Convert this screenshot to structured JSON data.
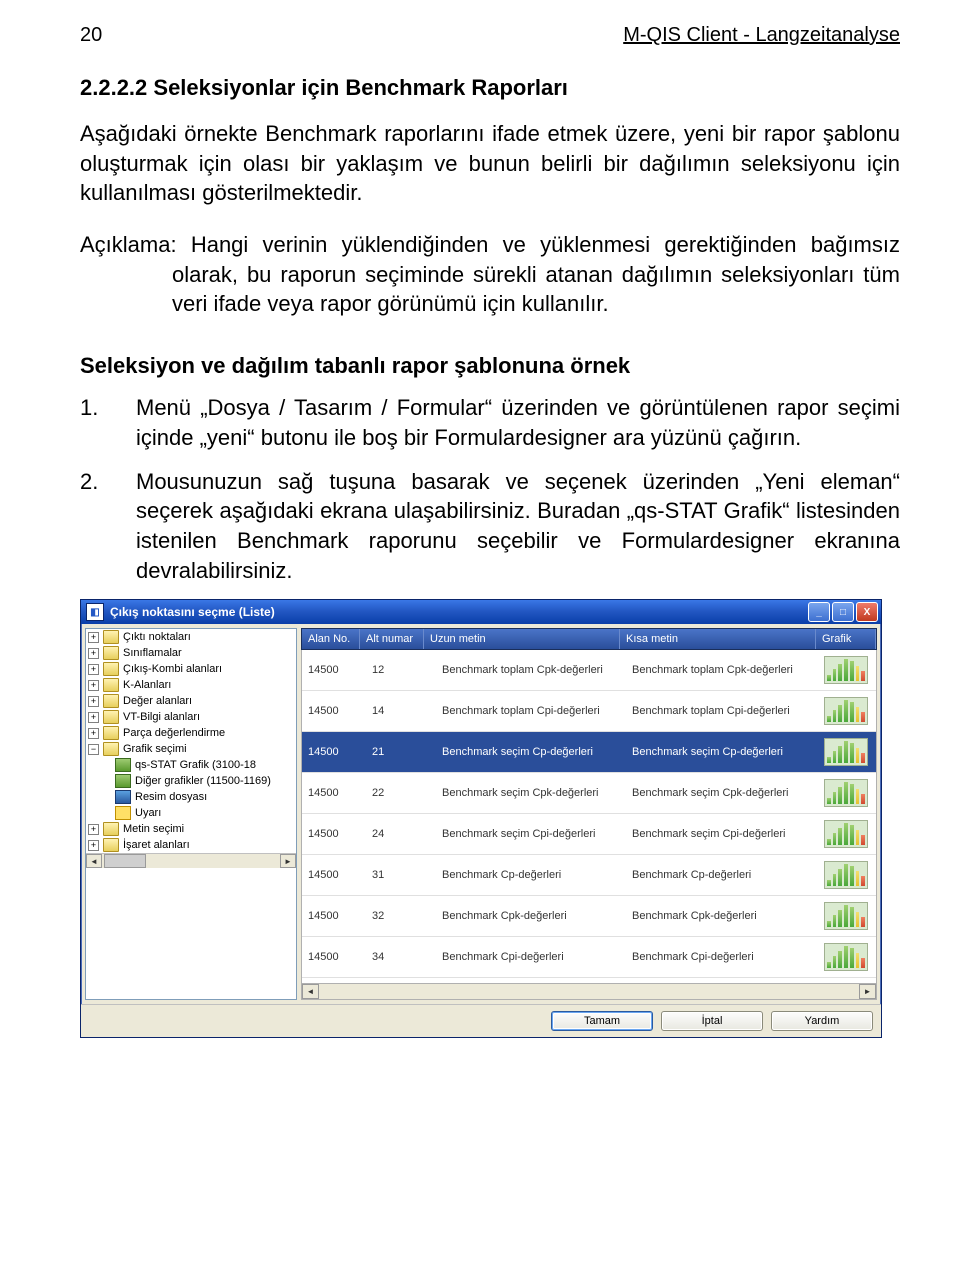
{
  "header": {
    "page_no": "20",
    "doc_title": "M-QIS Client - Langzeitanalyse"
  },
  "section": {
    "num_title": "2.2.2.2  Seleksiyonlar için Benchmark Raporları"
  },
  "para1": "Aşağıdaki örnekte Benchmark raporlarını ifade etmek üzere, yeni bir rapor şablonu oluşturmak için olası bir yaklaşım ve bunun belirli bir dağılımın seleksiyonu için kullanılması gösterilmektedir.",
  "para2": "Açıklama: Hangi verinin yüklendiğinden ve yüklenmesi gerektiğinden bağımsız olarak, bu raporun seçiminde sürekli atanan dağılımın seleksiyonları tüm veri ifade veya rapor görünümü için kullanılır.",
  "subheading": "Seleksiyon ve dağılım tabanlı rapor şablonuna örnek",
  "list": {
    "item1_num": "1.",
    "item1_txt": "Menü „Dosya / Tasarım / Formular“ üzerinden ve görüntülenen rapor seçimi içinde „yeni“ butonu ile boş bir Formulardesigner ara yüzünü çağırın.",
    "item2_num": "2.",
    "item2_txt": "Mousunuzun sağ tuşuna basarak ve seçenek üzerinden „Yeni eleman“ seçerek aşağıdaki ekrana ulaşabilirsiniz. Buradan „qs-STAT Grafik“ listesinden istenilen Benchmark raporunu seçebilir ve Formulardesigner ekranına devralabilirsiniz."
  },
  "window": {
    "title": "Çıkış noktasını seçme (Liste)",
    "tree": [
      {
        "indent": 0,
        "pm": "+",
        "icon": "folder",
        "label": "Çıktı noktaları"
      },
      {
        "indent": 0,
        "pm": "+",
        "icon": "folder",
        "label": "Sınıflamalar"
      },
      {
        "indent": 0,
        "pm": "+",
        "icon": "folder",
        "label": "Çıkış-Kombi alanları"
      },
      {
        "indent": 0,
        "pm": "+",
        "icon": "folder",
        "label": "K-Alanları"
      },
      {
        "indent": 0,
        "pm": "+",
        "icon": "folder",
        "label": "Değer alanları"
      },
      {
        "indent": 0,
        "pm": "+",
        "icon": "folder",
        "label": "VT-Bilgi alanları"
      },
      {
        "indent": 0,
        "pm": "+",
        "icon": "folder",
        "label": "Parça değerlendirme"
      },
      {
        "indent": 0,
        "pm": "−",
        "icon": "folder",
        "label": "Grafik seçimi"
      },
      {
        "indent": 1,
        "pm": "",
        "icon": "img",
        "label": "qs-STAT Grafik (3100-18"
      },
      {
        "indent": 1,
        "pm": "",
        "icon": "img",
        "label": "Diğer grafikler (11500-1169)"
      },
      {
        "indent": 1,
        "pm": "",
        "icon": "disk",
        "label": "Resim dosyası"
      },
      {
        "indent": 1,
        "pm": "",
        "icon": "warn",
        "label": "Uyarı"
      },
      {
        "indent": 0,
        "pm": "+",
        "icon": "folder",
        "label": "Metin seçimi"
      },
      {
        "indent": 0,
        "pm": "+",
        "icon": "folder",
        "label": "İşaret alanları"
      }
    ],
    "columns": {
      "c1": "Alan No.",
      "c2": "Alt numar",
      "c3": "Uzun metin",
      "c4": "Kısa metin",
      "c5": "Grafik"
    },
    "rows": [
      {
        "f1": "14500",
        "f2": "12",
        "f3": "Benchmark toplam Cpk-değerleri",
        "f4": "Benchmark toplam Cpk-değerleri",
        "sel": false
      },
      {
        "f1": "14500",
        "f2": "14",
        "f3": "Benchmark toplam Cpi-değerleri",
        "f4": "Benchmark toplam Cpi-değerleri",
        "sel": false
      },
      {
        "f1": "14500",
        "f2": "21",
        "f3": "Benchmark seçim Cp-değerleri",
        "f4": "Benchmark seçim Cp-değerleri",
        "sel": true
      },
      {
        "f1": "14500",
        "f2": "22",
        "f3": "Benchmark seçim Cpk-değerleri",
        "f4": "Benchmark seçim Cpk-değerleri",
        "sel": false
      },
      {
        "f1": "14500",
        "f2": "24",
        "f3": "Benchmark seçim Cpi-değerleri",
        "f4": "Benchmark seçim Cpi-değerleri",
        "sel": false
      },
      {
        "f1": "14500",
        "f2": "31",
        "f3": "Benchmark Cp-değerleri",
        "f4": "Benchmark Cp-değerleri",
        "sel": false
      },
      {
        "f1": "14500",
        "f2": "32",
        "f3": "Benchmark Cpk-değerleri",
        "f4": "Benchmark Cpk-değerleri",
        "sel": false
      },
      {
        "f1": "14500",
        "f2": "34",
        "f3": "Benchmark Cpi-değerleri",
        "f4": "Benchmark Cpi-değerleri",
        "sel": false
      }
    ],
    "buttons": {
      "ok": "Tamam",
      "cancel": "İptal",
      "help": "Yardım"
    }
  }
}
